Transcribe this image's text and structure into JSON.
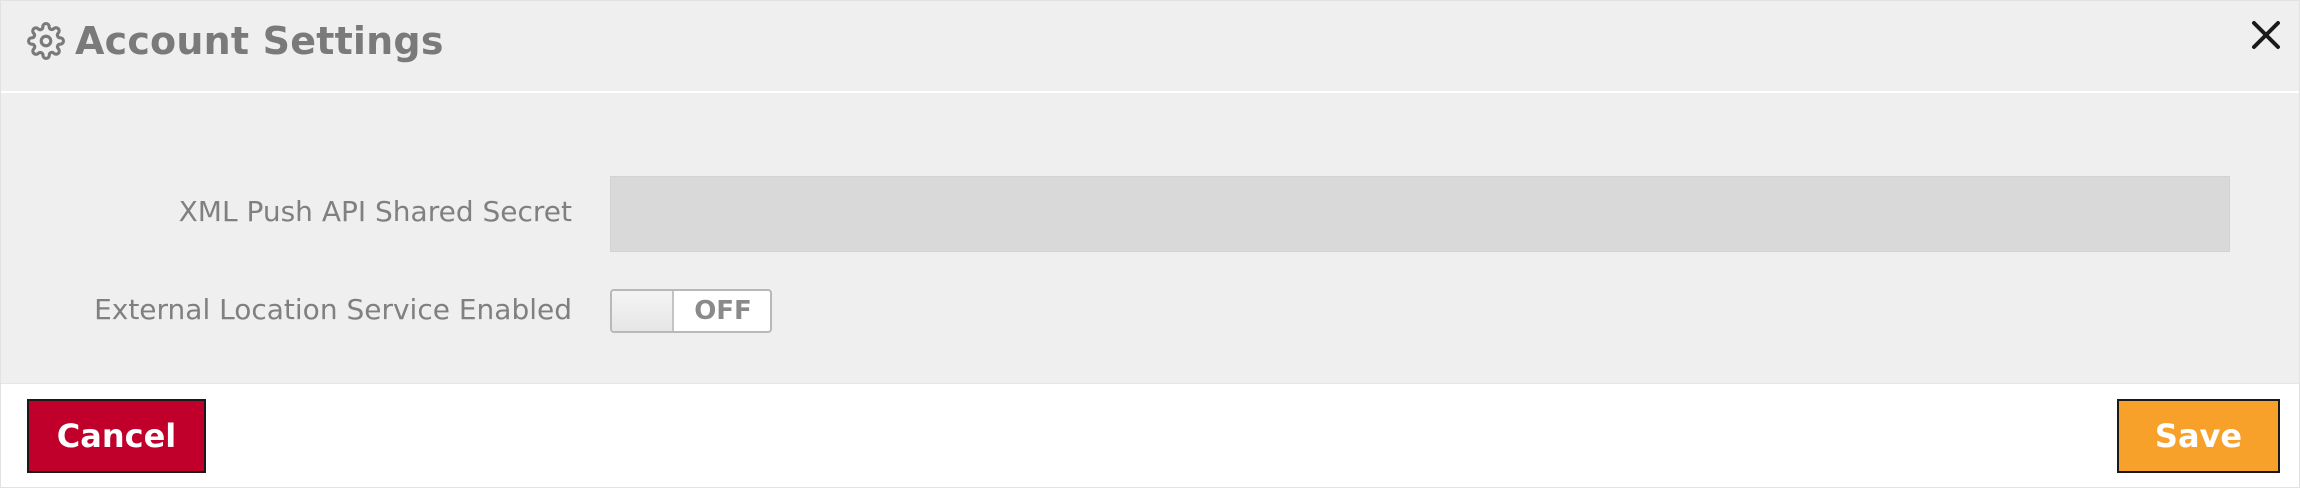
{
  "header": {
    "icon": "gear-icon",
    "title": "Account Settings",
    "close_icon": "close-icon"
  },
  "form": {
    "xml_push_secret": {
      "label": "XML Push API Shared Secret",
      "value": "",
      "placeholder": ""
    },
    "external_location": {
      "label": "External Location Service Enabled",
      "toggle_text": "OFF",
      "enabled": false
    }
  },
  "footer": {
    "cancel_label": "Cancel",
    "save_label": "Save"
  },
  "colors": {
    "cancel": "#c0002a",
    "save": "#f7a12a",
    "panel": "#efefef",
    "input": "#d9d9d9"
  }
}
